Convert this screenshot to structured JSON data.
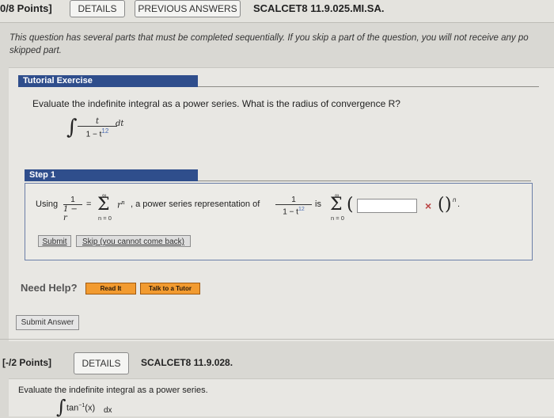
{
  "top": {
    "points": "0/8 Points]",
    "details_label": "DETAILS",
    "previous_answers_label": "PREVIOUS ANSWERS",
    "question_id": "SCALCET8 11.9.025.MI.SA."
  },
  "notice": "This question has several parts that must be completed sequentially. If you skip a part of the question, you will not receive any po skipped part.",
  "tutorial": {
    "header": "Tutorial Exercise",
    "prompt": "Evaluate the indefinite integral as a power series. What is the radius of convergence R?",
    "integrand_num": "t",
    "integrand_den": "1 − t",
    "integrand_den_exp": "12",
    "integrand_dt": "dt"
  },
  "step": {
    "title": "Step 1",
    "using": "Using",
    "frac1_num": "1",
    "frac1_den": "1 − r",
    "equals": "=",
    "sigma_lower": "n = 0",
    "sigma_upper": "∞",
    "r_term": "r",
    "r_exp": "n",
    "mid_text": ", a power series representation of",
    "frac2_num": "1",
    "frac2_den": "1 − t",
    "frac2_exp": "12",
    "is_text": "is",
    "paren_open": "(",
    "paren_close": ")",
    "outer_exp": "n",
    "period": ".",
    "answer_value": "",
    "x_mark": "×",
    "submit_label": "Submit",
    "skip_label": "Skip (you cannot come back)"
  },
  "help": {
    "label": "Need Help?",
    "read_it": "Read It",
    "talk_tutor": "Talk to a Tutor"
  },
  "submit_answer_label": "Submit Answer",
  "next": {
    "points": "[-/2 Points]",
    "details_label": "DETAILS",
    "question_id": "SCALCET8 11.9.028.",
    "prompt": "Evaluate the indefinite integral as a power series.",
    "integrand": "tan",
    "integrand_exp": "−1",
    "integrand_arg": "(x)",
    "integrand_dx": "dx"
  },
  "colors": {
    "ribbon": "#2f4e8c",
    "orange_button": "#f29b30",
    "x_mark": "#b44444"
  }
}
